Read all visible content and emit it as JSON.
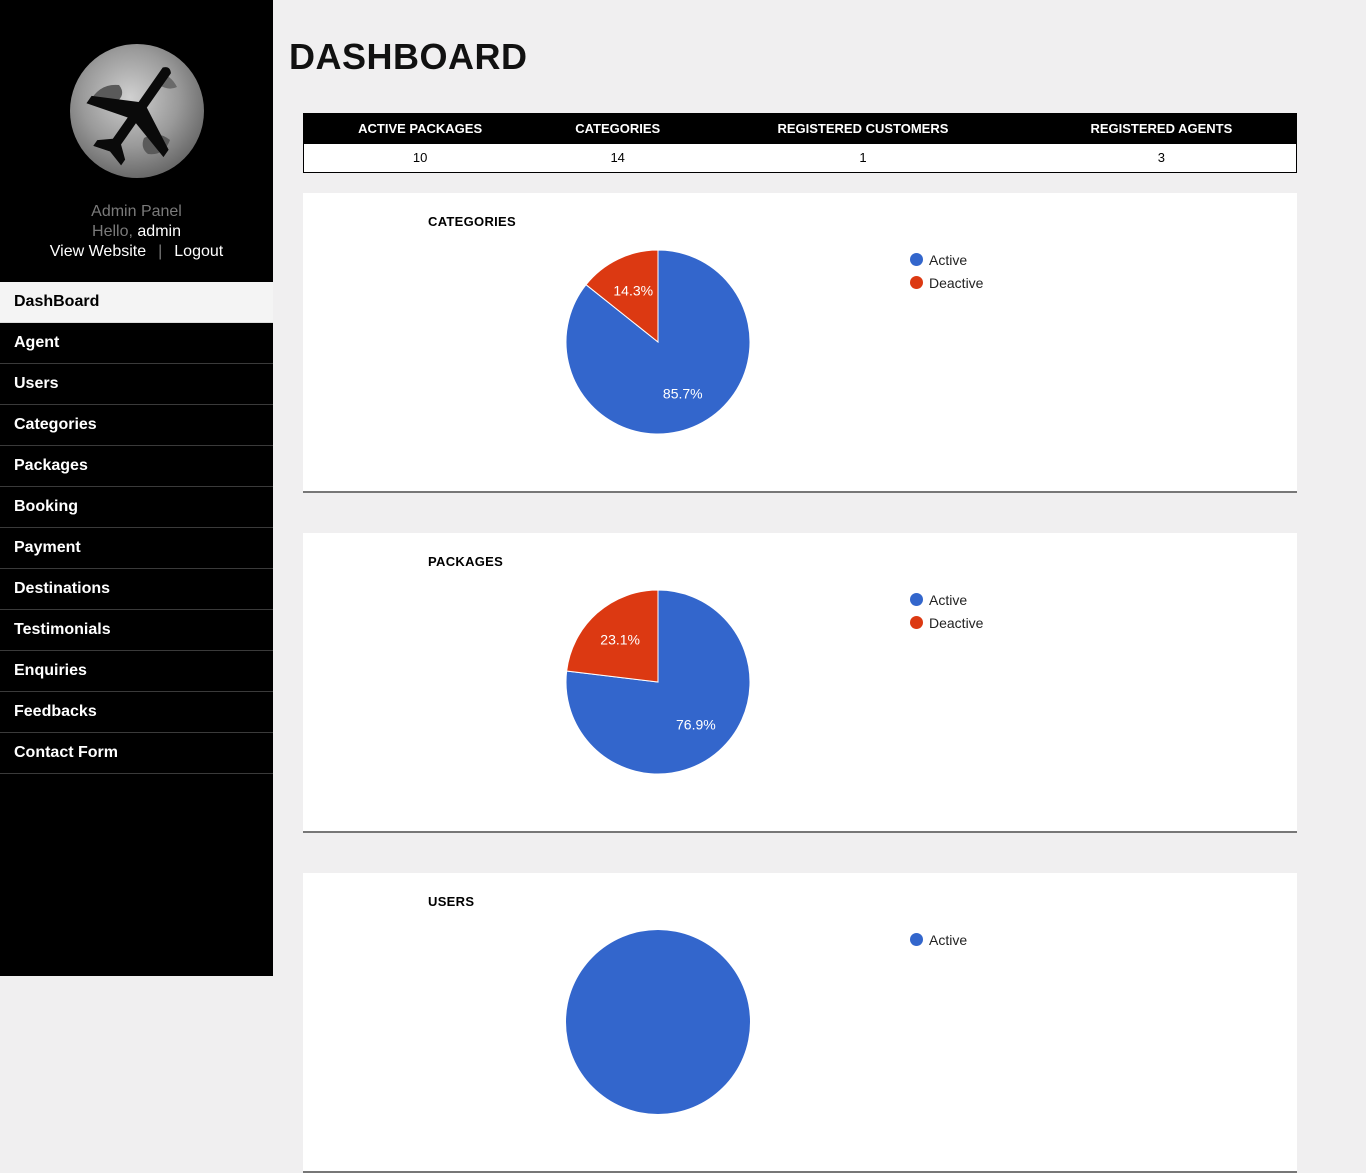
{
  "sidebar": {
    "panel_title": "Admin Panel",
    "hello_label": "Hello,",
    "username": "admin",
    "view_website": "View Website",
    "separator": "|",
    "logout": "Logout",
    "logo_icon": "airplane-globe-icon",
    "menu": [
      {
        "label": "DashBoard",
        "active": true
      },
      {
        "label": "Agent"
      },
      {
        "label": "Users"
      },
      {
        "label": "Categories"
      },
      {
        "label": "Packages"
      },
      {
        "label": "Booking"
      },
      {
        "label": "Payment"
      },
      {
        "label": "Destinations"
      },
      {
        "label": "Testimonials"
      },
      {
        "label": "Enquiries"
      },
      {
        "label": "Feedbacks"
      },
      {
        "label": "Contact Form"
      }
    ]
  },
  "main": {
    "title": "DASHBOARD",
    "stats": {
      "headers": [
        "ACTIVE PACKAGES",
        "CATEGORIES",
        "REGISTERED CUSTOMERS",
        "REGISTERED AGENTS"
      ],
      "values": [
        "10",
        "14",
        "1",
        "3"
      ]
    }
  },
  "colors": {
    "active": "#3366cc",
    "deactive": "#dc3912"
  },
  "chart_data": [
    {
      "type": "pie",
      "title": "CATEGORIES",
      "labels": [
        "Active",
        "Deactive"
      ],
      "values": [
        85.7,
        14.3
      ],
      "value_labels": [
        "85.7%",
        "14.3%"
      ],
      "legend": "right"
    },
    {
      "type": "pie",
      "title": "PACKAGES",
      "labels": [
        "Active",
        "Deactive"
      ],
      "values": [
        76.9,
        23.1
      ],
      "value_labels": [
        "76.9%",
        "23.1%"
      ],
      "legend": "right"
    },
    {
      "type": "pie",
      "title": "USERS",
      "labels": [
        "Active"
      ],
      "values": [
        100
      ],
      "value_labels": [
        ""
      ],
      "legend": "right"
    }
  ]
}
